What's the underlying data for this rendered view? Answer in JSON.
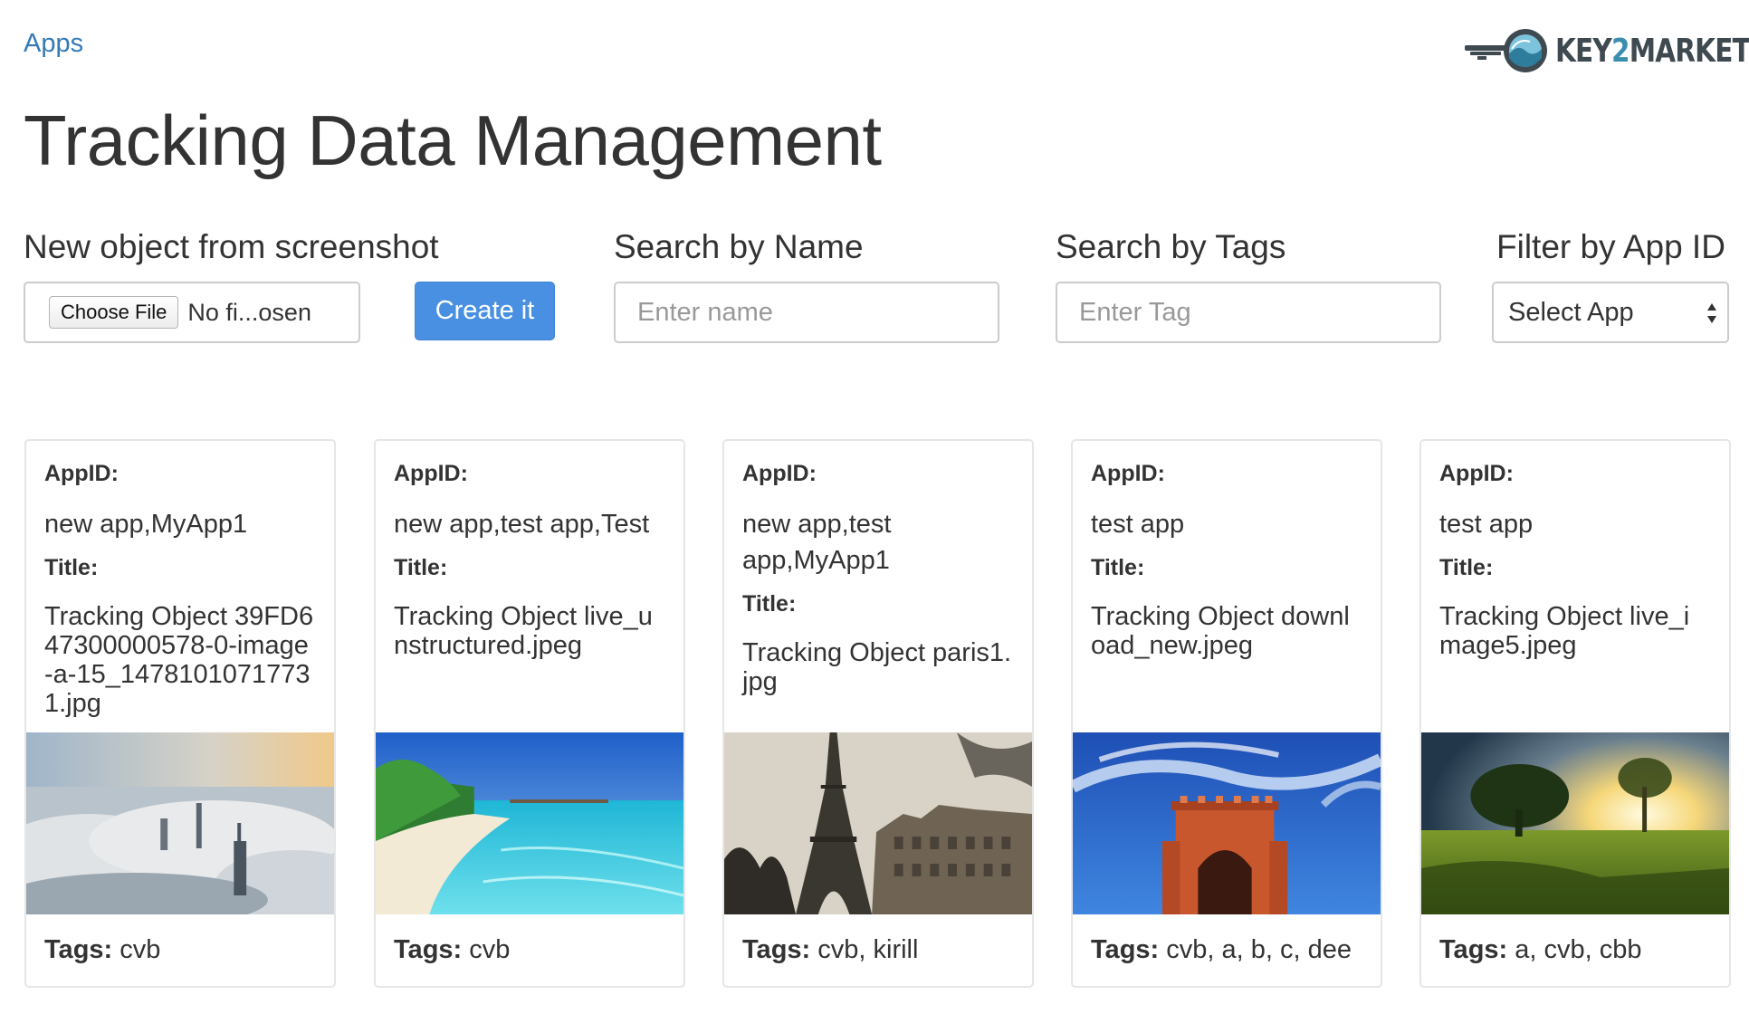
{
  "nav": {
    "apps_link": "Apps"
  },
  "logo": {
    "text_pre": "KEY",
    "text_num": "2",
    "text_post": "MARKET"
  },
  "page_title": "Tracking Data Management",
  "new_object": {
    "label": "New object from screenshot",
    "choose_file": "Choose File",
    "file_status": "No fi...osen",
    "create_button": "Create it"
  },
  "search_name": {
    "label": "Search by Name",
    "placeholder": "Enter name"
  },
  "search_tags": {
    "label": "Search by Tags",
    "placeholder": "Enter Tag"
  },
  "filter_app": {
    "label": "Filter by App ID",
    "selected": "Select App"
  },
  "card_labels": {
    "appid": "AppID:",
    "title": "Title:",
    "tags": "Tags:"
  },
  "cards": [
    {
      "appid": "new app,MyApp1",
      "title": "Tracking Object 39FD647300000578-0-image-a-15_14781010717731.jpg",
      "tags": "cvb",
      "image": "city-above-clouds-image"
    },
    {
      "appid": "new app,test app,Test",
      "title": "Tracking Object live_unstructured.jpeg",
      "tags": "cvb",
      "image": "tropical-beach-image"
    },
    {
      "appid": "new app,test app,MyApp1",
      "title": "Tracking Object paris1.jpg",
      "tags": "cvb, kirill",
      "image": "eiffel-tower-image"
    },
    {
      "appid": "test app",
      "title": "Tracking Object download_new.jpeg",
      "tags": "cvb, a, b, c, dee",
      "image": "red-gate-blue-sky-image"
    },
    {
      "appid": "test app",
      "title": "Tracking Object live_image5.jpeg",
      "tags": "a, cvb, cbb",
      "image": "meadow-sunset-tree-image"
    }
  ]
}
